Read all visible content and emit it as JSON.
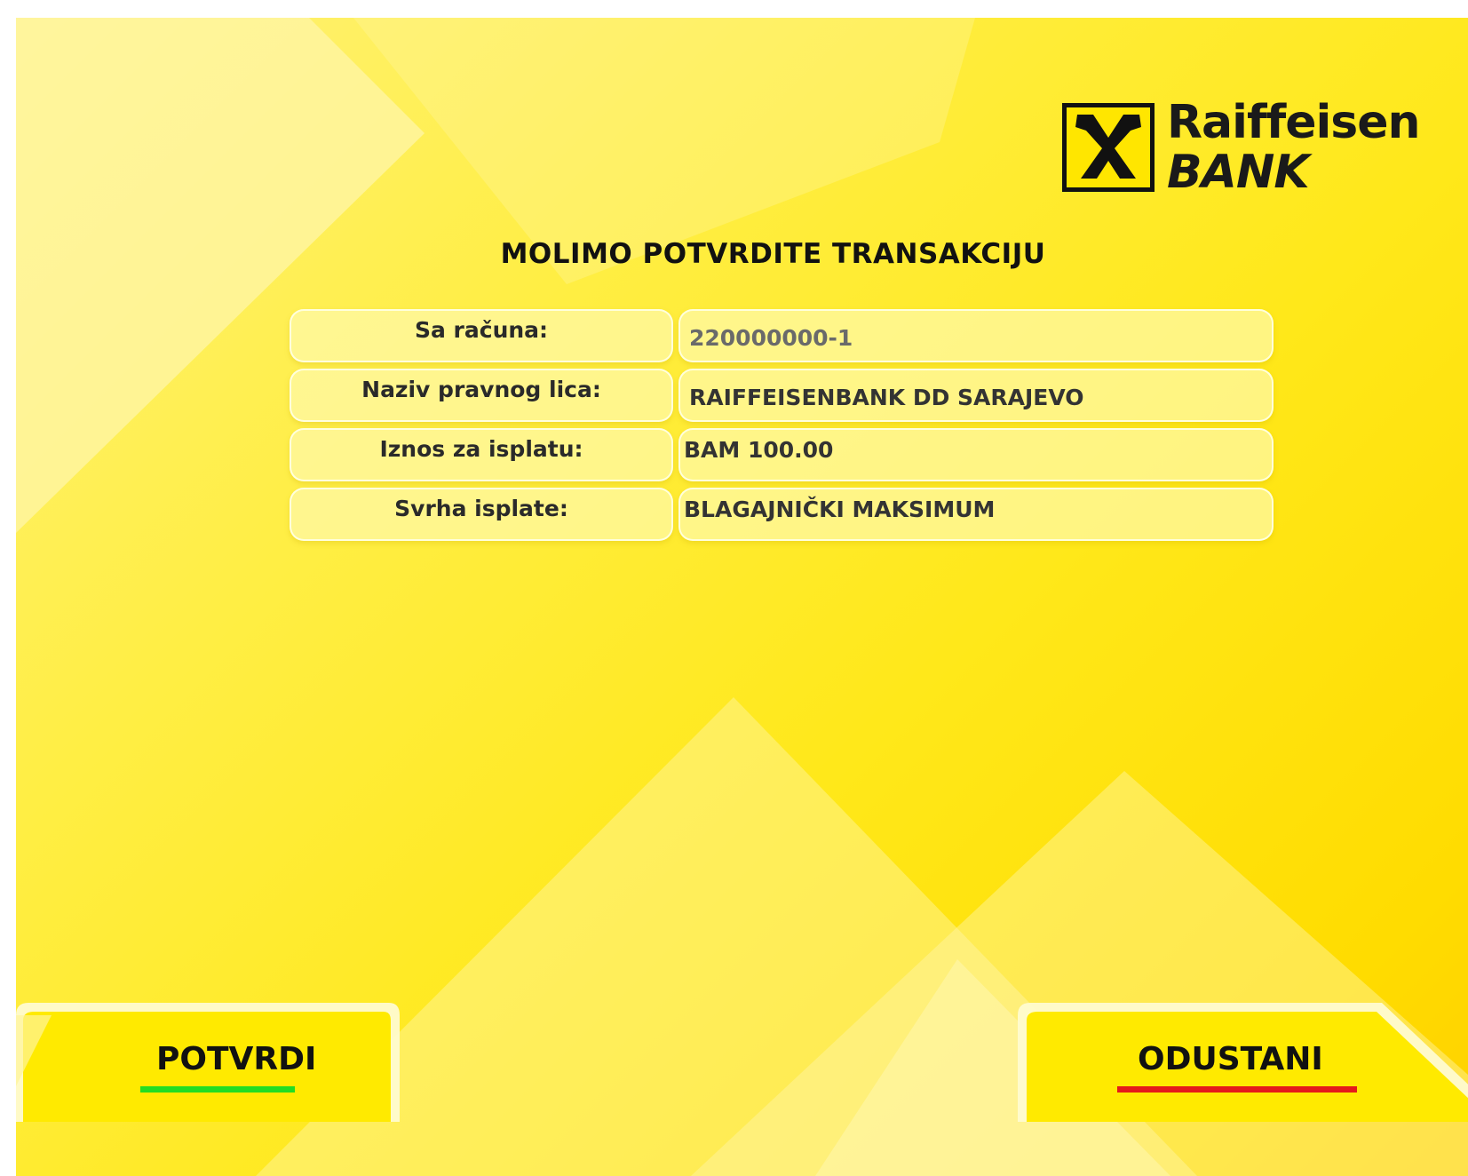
{
  "brand": {
    "name": "Raiffeisen",
    "sub": "BANK",
    "logo_icon": "crossed-horse-heads-icon"
  },
  "title": "MOLIMO POTVRDITE TRANSAKCIJU",
  "details": [
    {
      "label": "Sa računa:",
      "value": "220000000-1"
    },
    {
      "label": "Naziv pravnog lica:",
      "value": "RAIFFEISENBANK DD SARAJEVO"
    },
    {
      "label": "Iznos za isplatu:",
      "value": "BAM 100.00"
    },
    {
      "label": "Svrha isplate:",
      "value": "BLAGAJNIČKI MAKSIMUM"
    }
  ],
  "actions": {
    "confirm": {
      "label": "POTVRDI",
      "accent": "#22dd22"
    },
    "cancel": {
      "label": "ODUSTANI",
      "accent": "#e51a1a"
    }
  },
  "colors": {
    "background": "#ffe600",
    "text": "#111111"
  }
}
